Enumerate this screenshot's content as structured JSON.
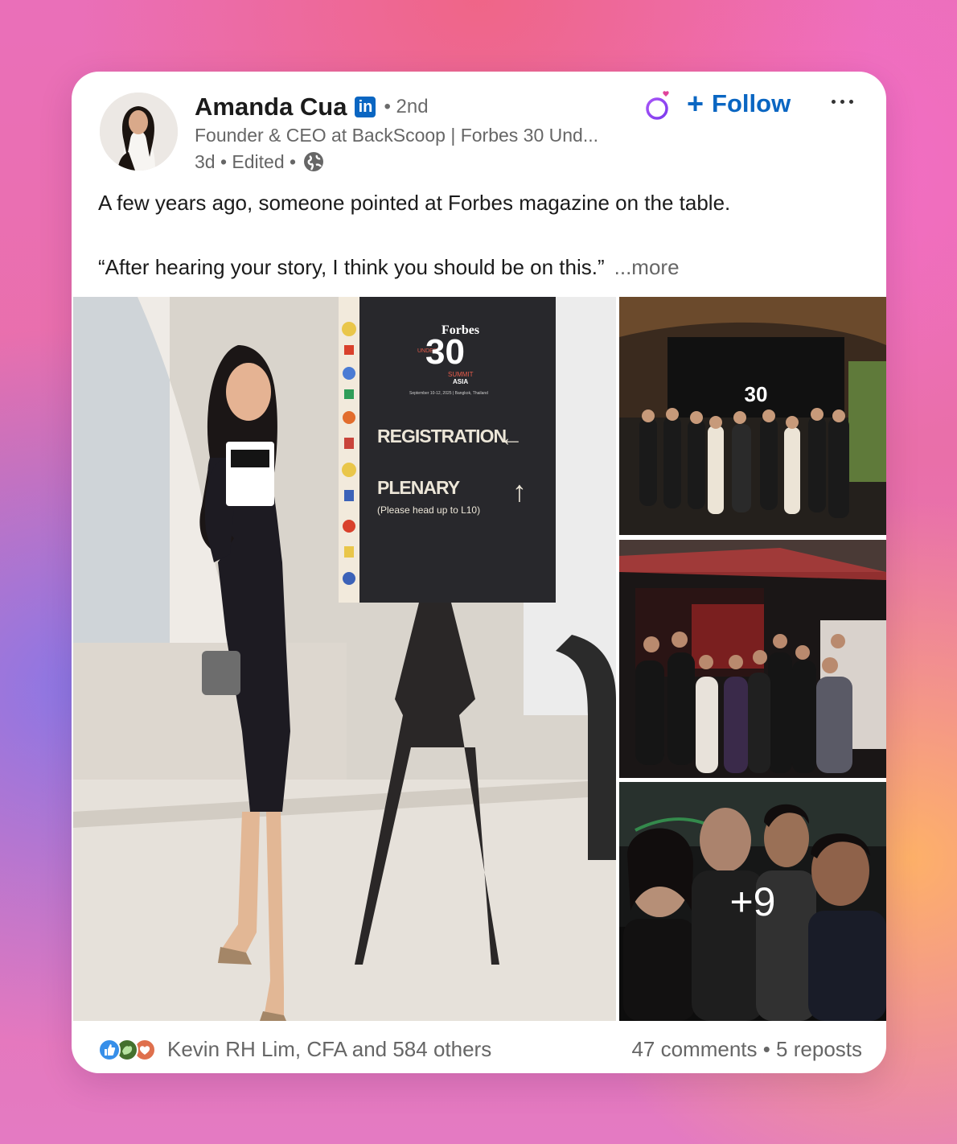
{
  "post": {
    "author": {
      "name": "Amanda Cua",
      "network_badge": "in",
      "degree": "• 2nd",
      "headline": "Founder & CEO at BackScoop | Forbes 30 Und...",
      "time_edited": "3d • Edited •"
    },
    "actions": {
      "follow_label": "Follow",
      "follow_plus": "+"
    },
    "text": {
      "line1": "A few years ago, someone pointed at Forbes magazine on the table.",
      "line2": "“After hearing your story, I think you should be on this.”",
      "more": "...more"
    },
    "sign": {
      "brand": "Forbes",
      "under": "UNDER",
      "number": "30",
      "summit": "SUMMIT",
      "asia": "ASIA",
      "dates": "September 10-12, 2025 | Bangkok, Thailand",
      "registration": "REGISTRATION",
      "plenary": "PLENARY",
      "plenary_note": "(Please head up to L10)"
    },
    "photos": {
      "extra_count": "+9"
    },
    "social": {
      "reactions": "Kevin RH Lim, CFA and 584 others",
      "counts": "47 comments • 5 reposts"
    }
  },
  "colors": {
    "linkedin_blue": "#0a66c2",
    "text_primary": "#1b1b1b",
    "text_secondary": "#666666"
  },
  "icons": [
    "linkedin-icon",
    "globe-icon",
    "ring-icon",
    "more-icon",
    "like-icon",
    "celebrate-icon",
    "love-icon"
  ]
}
